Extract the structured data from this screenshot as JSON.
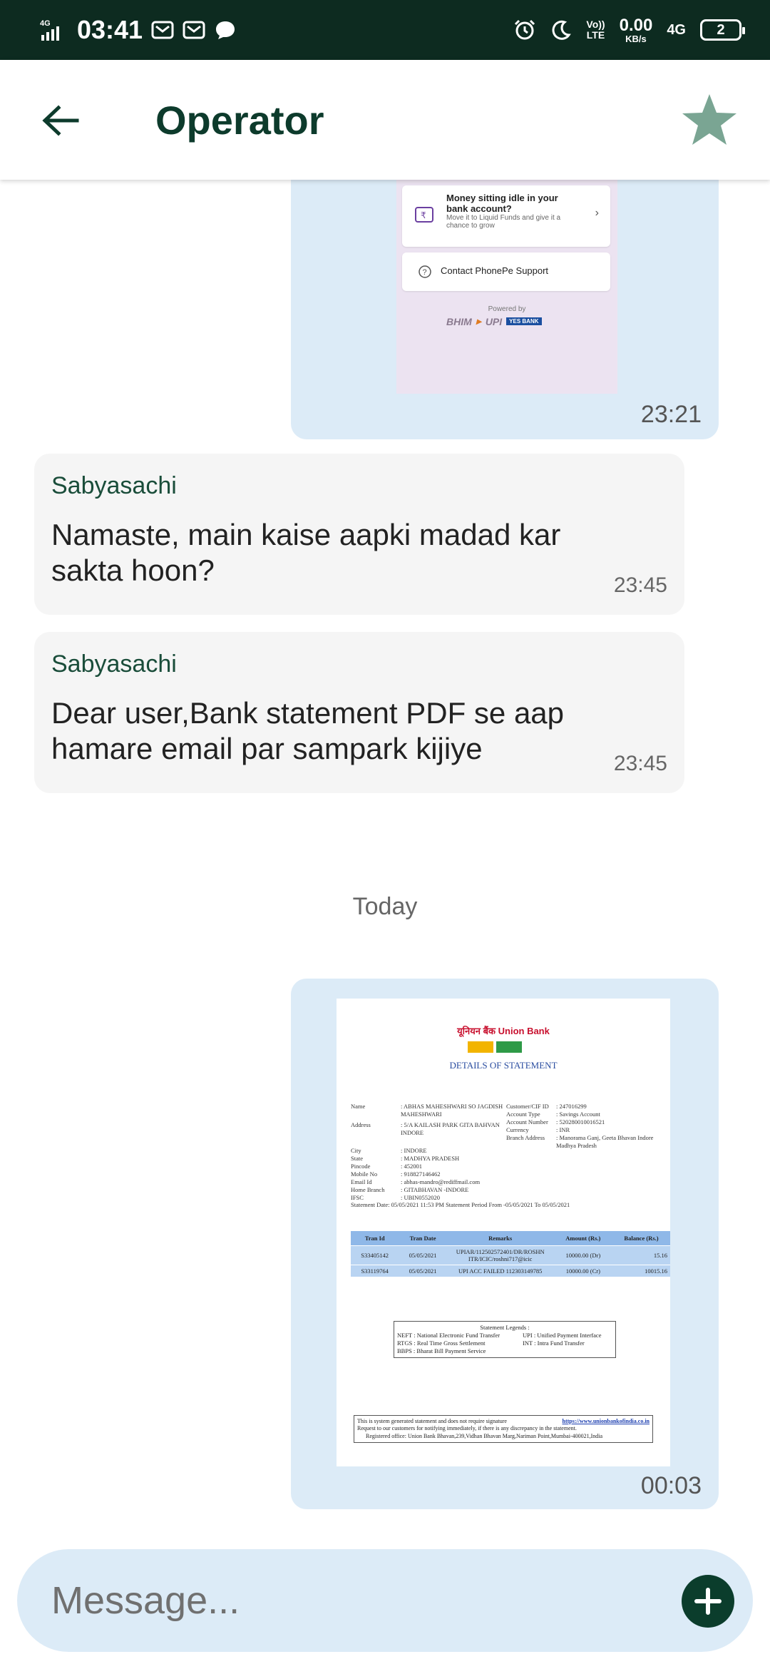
{
  "status_bar": {
    "network_left": "4G",
    "time": "03:41",
    "speed_value": "0.00",
    "speed_unit": "KB/s",
    "volte_top": "Vo))",
    "volte_bottom": "LTE",
    "network_right": "4G",
    "battery": "2"
  },
  "header": {
    "title": "Operator"
  },
  "chat": {
    "phonepe_image": {
      "card1_title": "Money sitting idle in your bank account?",
      "card1_sub": "Move it to Liquid Funds and give it a chance to grow",
      "card2_title": "Contact PhonePe Support",
      "powered_by": "Powered by",
      "logo_bhim": "BHIM",
      "logo_upi": "UPI",
      "logo_yes": "YES BANK",
      "time": "23:21"
    },
    "messages": [
      {
        "sender": "Sabyasachi",
        "text": "Namaste, main kaise aapki madad kar sakta hoon?",
        "time": "23:45"
      },
      {
        "sender": "Sabyasachi",
        "text": "Dear user,Bank statement PDF se aap hamare email par sampark kijiye",
        "time": "23:45"
      }
    ],
    "day_separator": "Today",
    "statement_image": {
      "bank_name": "यूनियन बैंक Union Bank",
      "heading": "DETAILS OF STATEMENT",
      "left_fields": [
        {
          "k": "Name",
          "v": ": ABHAS MAHESHWARI SO JAGDISH MAHESHWARI"
        },
        {
          "k": "Address",
          "v": ": 5/A KAILASH PARK GITA BAHVAN INDORE"
        },
        {
          "k": "City",
          "v": ": INDORE"
        },
        {
          "k": "State",
          "v": ": MADHYA PRADESH"
        },
        {
          "k": "Pincode",
          "v": ": 452001"
        },
        {
          "k": "Mobile No",
          "v": ": 918827146462"
        },
        {
          "k": "Email Id",
          "v": ": abhas-mandro@rediffmail.com"
        },
        {
          "k": "Home Branch",
          "v": ": GITABHAVAN -INDORE"
        },
        {
          "k": "IFSC",
          "v": ": UBIN0552020"
        }
      ],
      "right_fields": [
        {
          "k": "Customer/CIF ID",
          "v": ": 247016299"
        },
        {
          "k": "Account Type",
          "v": ": Savings Account"
        },
        {
          "k": "Account Number",
          "v": ": 520280010016521"
        },
        {
          "k": "Currency",
          "v": ": INR"
        },
        {
          "k": "Branch Address",
          "v": ": Manorama Ganj, Geeta Bhavan Indore Madhya Pradesh"
        }
      ],
      "period": "Statement Date: 05/05/2021 11:53 PM     Statement Period From -05/05/2021 To 05/05/2021",
      "table_headers": [
        "Tran Id",
        "Tran Date",
        "Remarks",
        "Amount (Rs.)",
        "Balance (Rs.)"
      ],
      "table_rows": [
        [
          "S33405142",
          "05/05/2021",
          "UPIAR/112502572401/DR/ROSHN ITR/ICIC/roshni717@icic",
          "10000.00 (Dr)",
          "15.16"
        ],
        [
          "S33119764",
          "05/05/2021",
          "UPI ACC FAILED 112303149785",
          "10000.00 (Cr)",
          "10015.16"
        ]
      ],
      "legend_title": "Statement Legends :",
      "legend_rows": [
        [
          "NEFT : National Electronic Fund Transfer",
          "UPI : Unified Payment Interface"
        ],
        [
          "RTGS : Real Time Gross Settlement",
          "INT : Intra Fund Transfer"
        ],
        [
          "BBPS : Bharat Bill Payment Service",
          ""
        ]
      ],
      "footer_line1": "This is system generated statement and does not require signature",
      "footer_link": "https://www.unionbankofindia.co.in",
      "footer_line2": "Request to our customers for notifying immediately, if there is any discrepancy in the statement.",
      "footer_line3": "Registered office: Union Bank Bhavan,239,Vidhan Bhavan Marg,Nariman Point,Mumbai-400021,India",
      "time": "00:03"
    }
  },
  "composer": {
    "placeholder": "Message..."
  },
  "colors": {
    "status_bar_bg": "#0d2b20",
    "accent_dark_green": "#0d3b2c",
    "star": "#7aa593",
    "outgoing_bubble": "#dcebf7",
    "incoming_bubble": "#f5f5f5"
  },
  "icons": {
    "back": "arrow-left-icon",
    "favorite": "star-icon",
    "add": "plus-icon"
  }
}
